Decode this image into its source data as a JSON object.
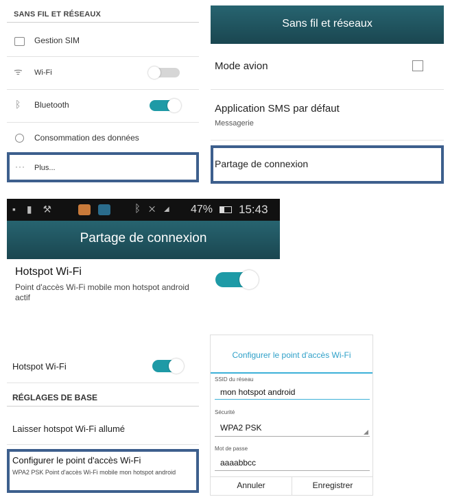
{
  "panel1": {
    "section_header": "SANS FIL ET RÉSEAUX",
    "items": [
      {
        "label": "Gestion SIM",
        "icon": "sim-card-icon"
      },
      {
        "label": "Wi-Fi",
        "icon": "wifi-icon",
        "toggle": "off"
      },
      {
        "label": "Bluetooth",
        "icon": "bluetooth-icon",
        "toggle": "on"
      },
      {
        "label": "Consommation des données",
        "icon": "data-usage-icon"
      },
      {
        "label": "Plus...",
        "icon": "more-dots-icon"
      }
    ]
  },
  "panel2": {
    "title": "Sans fil et réseaux",
    "items": [
      {
        "label": "Mode avion"
      },
      {
        "label": "Application SMS par défaut",
        "sublabel": "Messagerie"
      },
      {
        "label": "Partage de connexion"
      }
    ]
  },
  "panel3": {
    "status_bar": {
      "battery": "47%",
      "time": "15:43"
    },
    "title": "Partage de connexion",
    "item": {
      "label": "Hotspot Wi-Fi",
      "sublabel": "Point d'accès Wi-Fi mobile mon hotspot android actif",
      "toggle": "on"
    }
  },
  "panel4": {
    "hotspot_label": "Hotspot Wi-Fi",
    "section_header": "RÉGLAGES DE BASE",
    "keep_on_label": "Laisser hotspot Wi-Fi allumé",
    "configure_label": "Configurer le point d'accès Wi-Fi",
    "configure_sub": "WPA2 PSK Point d'accès Wi-Fi mobile mon hotspot android"
  },
  "panel5": {
    "title": "Configurer le point d'accès Wi-Fi",
    "ssid_label": "SSID du réseau",
    "ssid_value": "mon hotspot android",
    "security_label": "Sécurité",
    "security_value": "WPA2 PSK",
    "password_label": "Mot de passe",
    "password_value": "aaaabbcc",
    "cancel": "Annuler",
    "save": "Enregistrer"
  },
  "colors": {
    "teal_header": "#1f5059",
    "toggle_on": "#1e9aa6",
    "highlight_border": "#3d5f8d",
    "dialog_title": "#2ea0c8"
  }
}
